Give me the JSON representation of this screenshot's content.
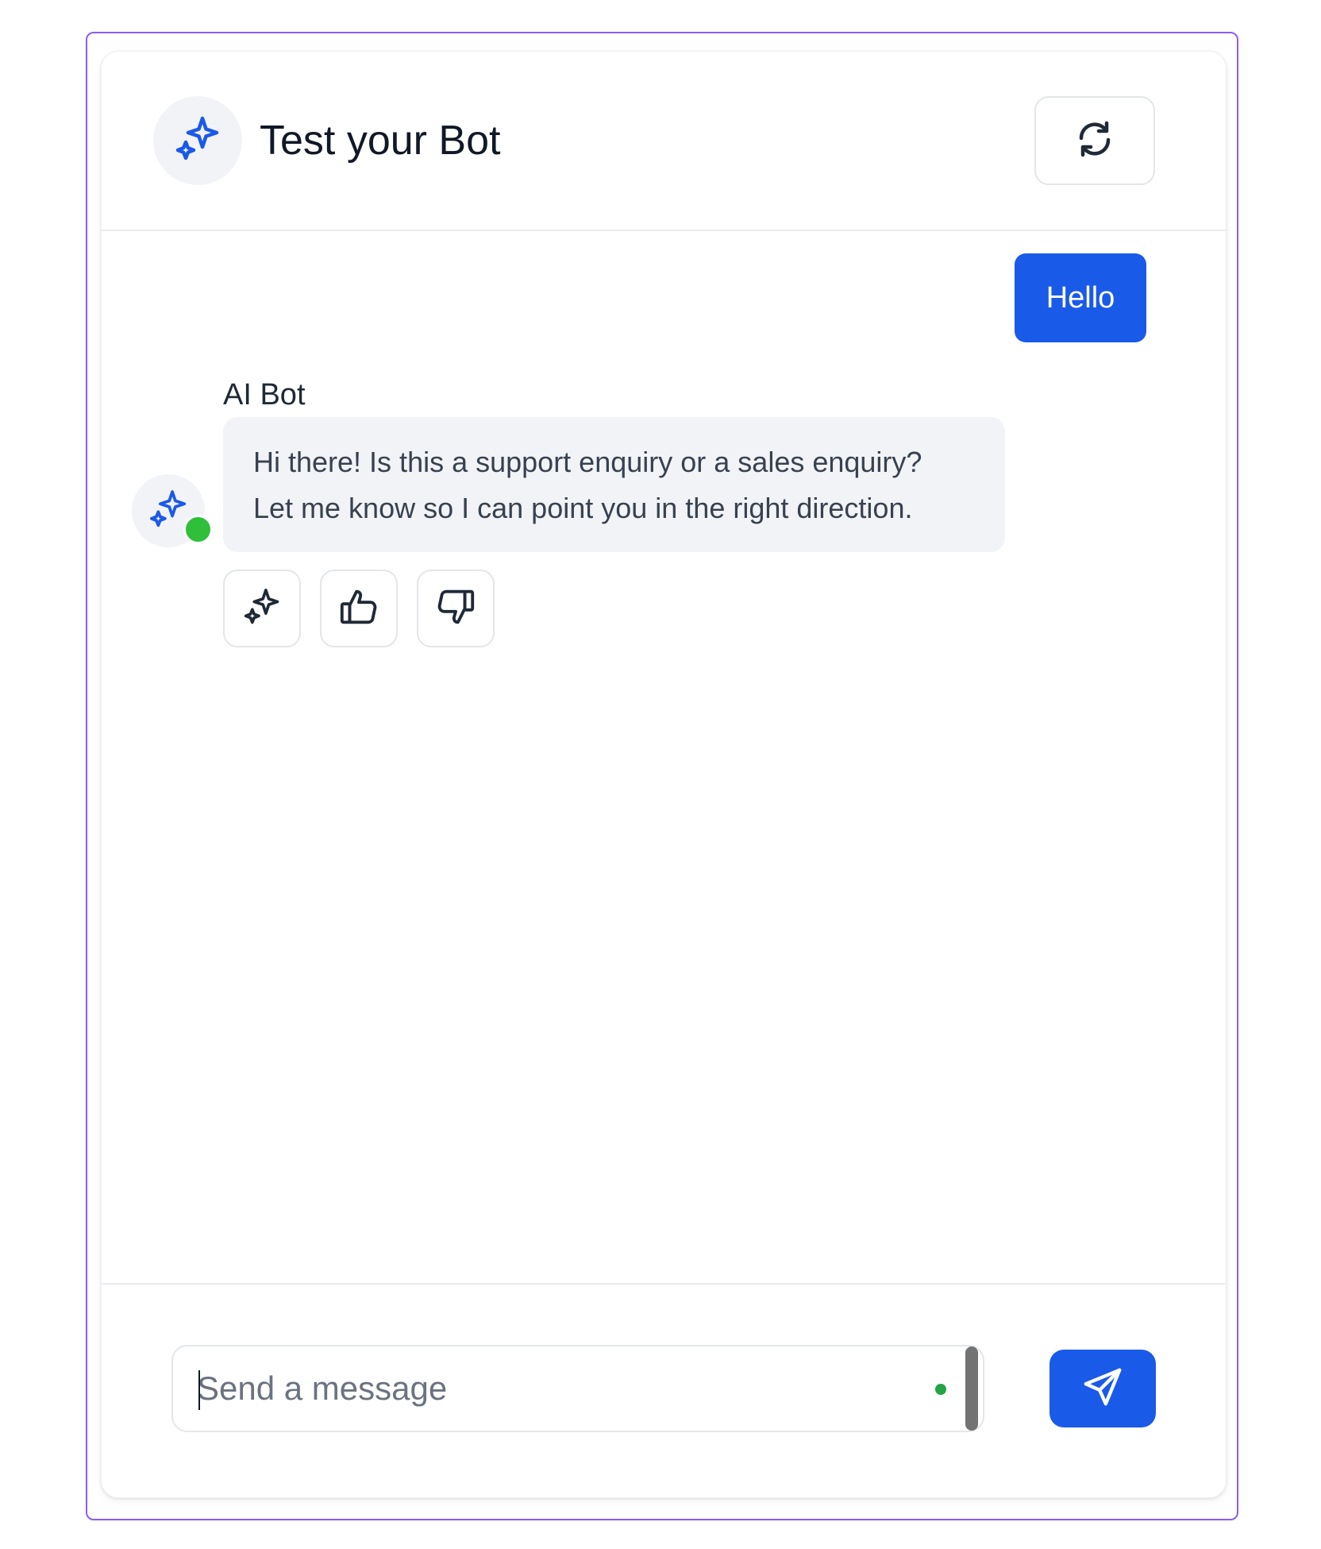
{
  "header": {
    "title": "Test your Bot",
    "avatar_icon": "sparkles-icon",
    "refresh_icon": "refresh-icon"
  },
  "messages": {
    "user": {
      "text": "Hello"
    },
    "bot": {
      "name": "AI Bot",
      "lines": [
        "Hi there! Is this a support enquiry or a sales enquiry?",
        "Let me know so I can point you in the right direction."
      ],
      "status": "online",
      "actions": [
        {
          "icon": "sparkles-icon"
        },
        {
          "icon": "thumbs-up-icon"
        },
        {
          "icon": "thumbs-down-icon"
        }
      ]
    }
  },
  "composer": {
    "placeholder": "Send a message",
    "value": "",
    "send_icon": "send-icon"
  },
  "colors": {
    "accent": "#1a5ae8",
    "online": "#2fbf3a",
    "frame": "#8b5cf6",
    "bubble_bg": "#f2f3f6"
  }
}
